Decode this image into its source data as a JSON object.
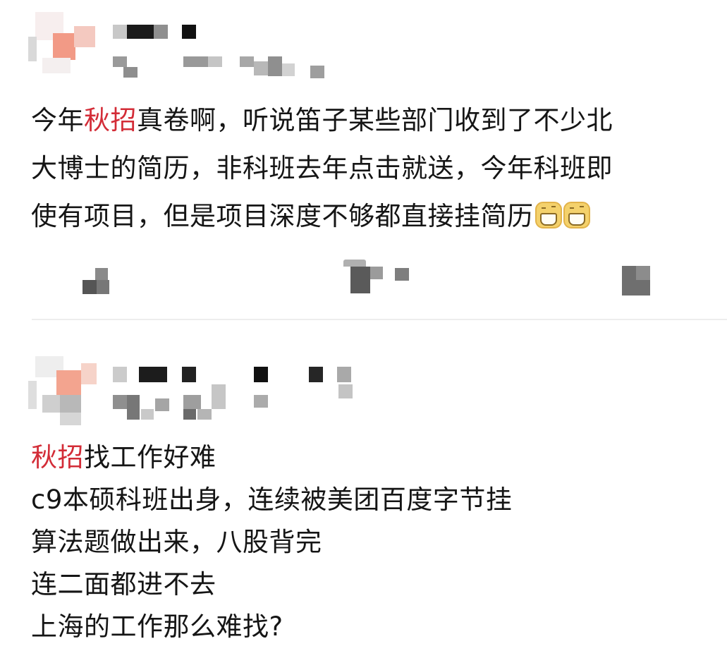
{
  "posts": [
    {
      "lines": [
        {
          "tag": "",
          "text": "今年",
          "tag2": "秋招",
          "rest": "真卷啊，听说笛子某些部门收到了不少北"
        },
        {
          "text": "大博士的简历，非科班去年点击就送，今年科班即"
        },
        {
          "text": "使有项目，但是项目深度不够都直接挂简历"
        }
      ],
      "emoji": [
        "grin-emoji",
        "grin-emoji"
      ]
    },
    {
      "tag": "秋招",
      "first_rest": "找工作好难",
      "lines": [
        "c9本硕科班出身，连续被美团百度字节挂",
        "算法题做出来，八股背完",
        "连二面都进不去",
        "上海的工作那么难找?"
      ]
    }
  ],
  "colors": {
    "tag": "#d32c37",
    "text": "#151515",
    "divider": "#ededed"
  }
}
